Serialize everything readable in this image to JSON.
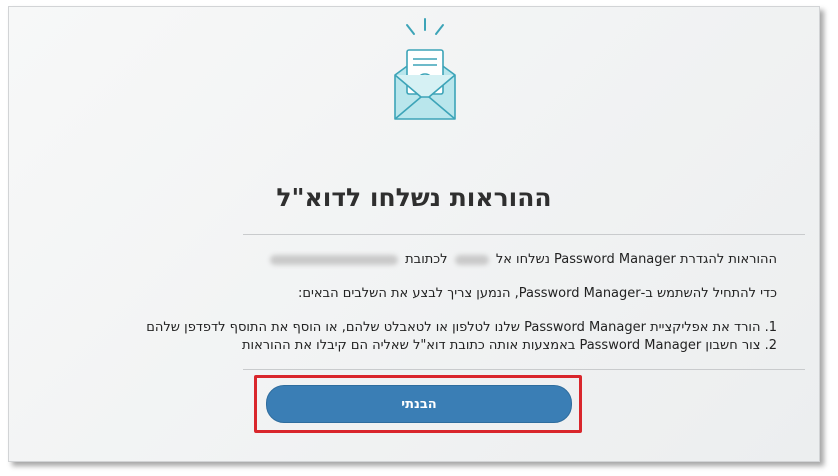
{
  "dialog": {
    "title": "ההוראות נשלחו לדוא\"ל",
    "line1": {
      "before": "ההוראות להגדרת Password Manager נשלחו אל",
      "after": "לכתובת"
    },
    "line2": "כדי להתחיל להשתמש ב-Password Manager, הנמען צריך לבצע את השלבים הבאים:",
    "steps": [
      "1. הורד את אפליקציית Password Manager שלנו לטלפון או לטאבלט שלהם, או הוסף את התוסף לדפדפן שלהם",
      "2. צור חשבון Password Manager באמצעות אותה כתובת דוא\"ל שאליה הם קיבלו את ההוראות"
    ],
    "ok_button_label": "הבנתי",
    "icon": "envelope-check-icon",
    "colors": {
      "button": "#3a7eb5",
      "highlight": "#d9262c",
      "icon_stroke": "#3da4b8",
      "icon_fill": "#b9e6ec"
    }
  }
}
